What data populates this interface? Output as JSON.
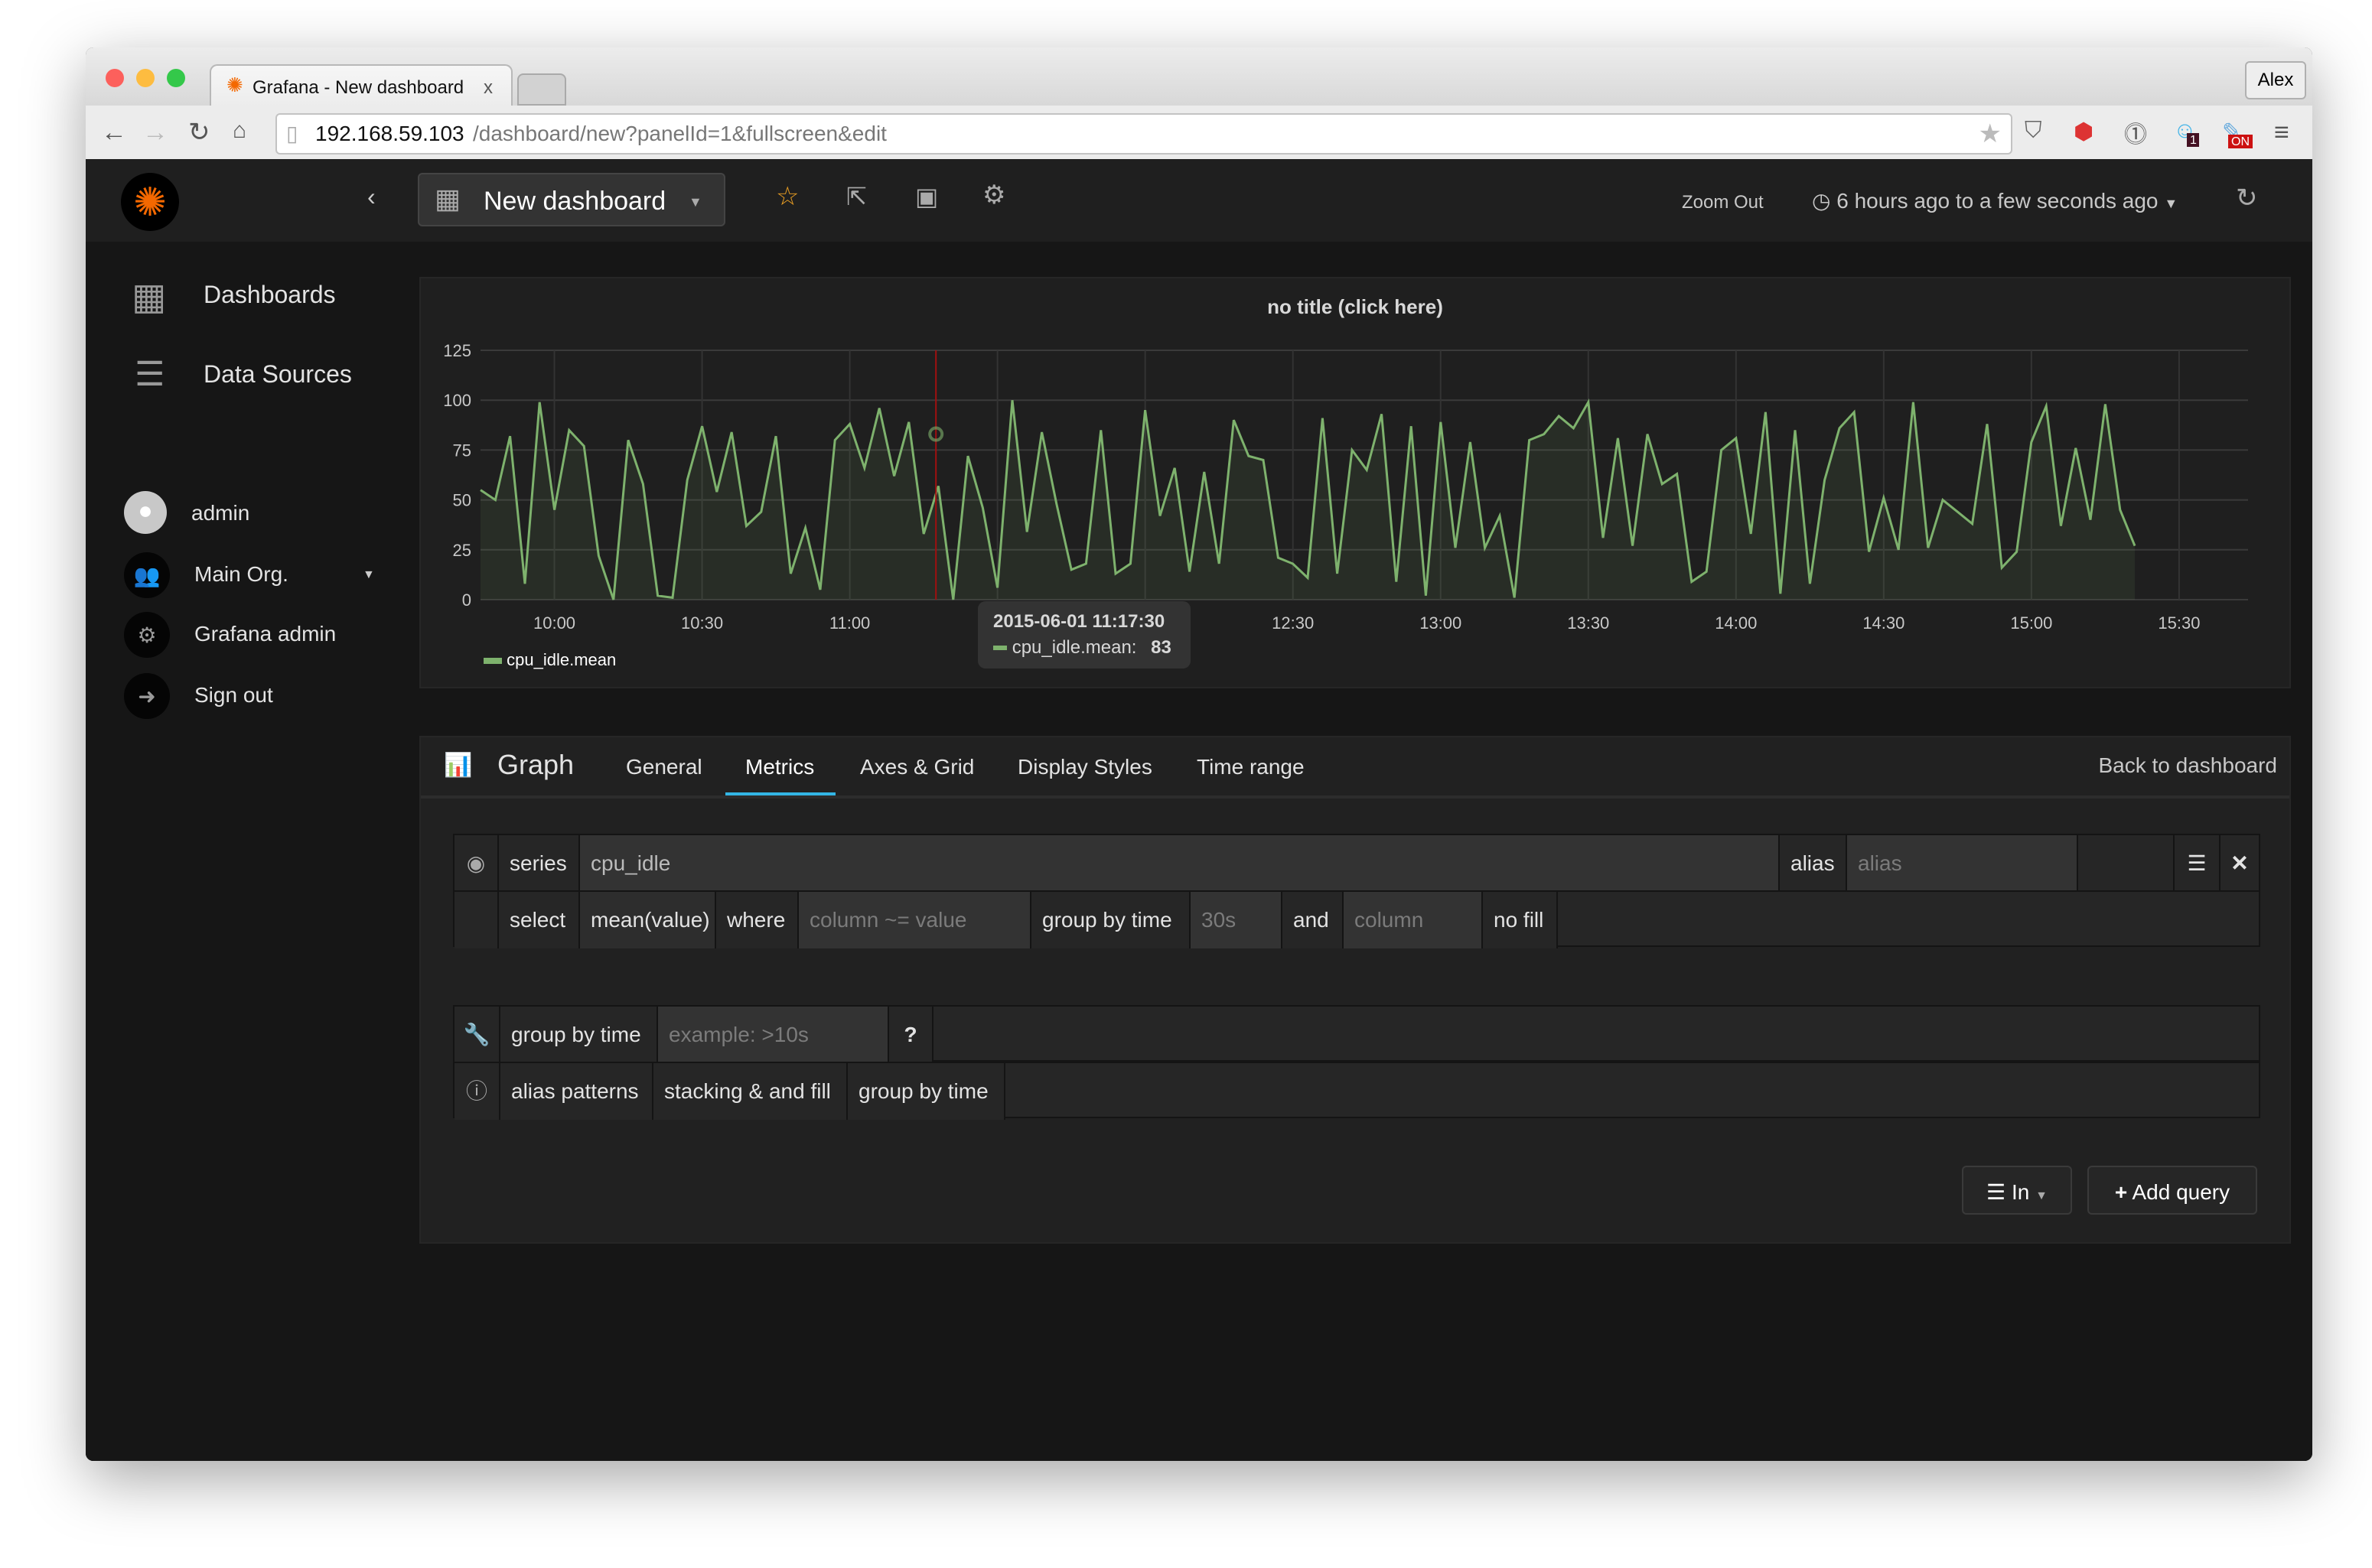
{
  "browser": {
    "tab_title": "Grafana - New dashboard",
    "tab_close": "x",
    "profile": "Alex",
    "url_host": "192.168.59.103",
    "url_path": "/dashboard/new?panelId=1&fullscreen&edit",
    "ext_badge_1": "1",
    "ext_badge_on": "ON"
  },
  "topnav": {
    "dashboard_title": "New dashboard",
    "zoom_out": "Zoom Out",
    "time_range": "6 hours ago to a few seconds ago"
  },
  "sidebar": {
    "items": [
      {
        "label": "Dashboards",
        "icon": "dashboards-icon"
      },
      {
        "label": "Data Sources",
        "icon": "database-icon"
      }
    ],
    "user": "admin",
    "org": "Main Org.",
    "admin": "Grafana admin",
    "signout": "Sign out"
  },
  "panel": {
    "title": "no title (click here)",
    "legend": "cpu_idle.mean",
    "tooltip": {
      "time": "2015-06-01 11:17:30",
      "series": "cpu_idle.mean:",
      "value": "83"
    }
  },
  "colors": {
    "series": "#7eb26d",
    "accent": "#33b5e5",
    "star": "#eb9f23",
    "crosshair": "#a01010"
  },
  "chart_data": {
    "type": "line",
    "title": "no title (click here)",
    "series": [
      {
        "name": "cpu_idle.mean",
        "values": [
          55,
          50,
          82,
          8,
          99,
          45,
          85,
          77,
          22,
          0,
          80,
          58,
          2,
          1,
          60,
          87,
          54,
          84,
          37,
          44,
          82,
          13,
          36,
          5,
          80,
          88,
          66,
          96,
          62,
          89,
          33,
          57,
          0,
          72,
          46,
          6,
          100,
          34,
          84,
          48,
          15,
          18,
          85,
          13,
          18,
          95,
          42,
          66,
          14,
          64,
          18,
          90,
          72,
          70,
          21,
          18,
          11,
          91,
          13,
          75,
          65,
          93,
          9,
          87,
          2,
          89,
          26,
          79,
          26,
          42,
          1,
          80,
          83,
          92,
          86,
          99,
          31,
          81,
          27,
          83,
          58,
          63,
          9,
          14,
          75,
          81,
          33,
          94,
          3,
          85,
          8,
          60,
          86,
          94,
          24,
          51,
          25,
          99,
          26,
          50,
          44,
          38,
          88,
          16,
          24,
          79,
          97,
          37,
          76,
          40,
          98,
          45,
          27
        ]
      }
    ],
    "x": [
      "09:45",
      "09:48",
      "09:51",
      "09:54",
      "09:57",
      "10:00",
      "10:03",
      "10:06",
      "10:09",
      "10:12",
      "10:15",
      "10:18",
      "10:21",
      "10:24",
      "10:27",
      "10:30",
      "10:33",
      "10:36",
      "10:39",
      "10:42",
      "10:45",
      "10:48",
      "10:51",
      "10:54",
      "10:57",
      "11:00",
      "11:03",
      "11:06",
      "11:09",
      "11:12",
      "11:15",
      "11:18",
      "11:21",
      "11:24",
      "11:27",
      "11:30",
      "11:33",
      "11:36",
      "11:39",
      "11:42",
      "11:45",
      "11:48",
      "11:51",
      "11:54",
      "11:57",
      "12:00",
      "12:03",
      "12:06",
      "12:09",
      "12:12",
      "12:15",
      "12:18",
      "12:21",
      "12:24",
      "12:27",
      "12:30",
      "12:33",
      "12:36",
      "12:39",
      "12:42",
      "12:45",
      "12:48",
      "12:51",
      "12:54",
      "12:57",
      "13:00",
      "13:03",
      "13:06",
      "13:09",
      "13:12",
      "13:15",
      "13:18",
      "13:21",
      "13:24",
      "13:27",
      "13:30",
      "13:33",
      "13:36",
      "13:39",
      "13:42",
      "13:45",
      "13:48",
      "13:51",
      "13:54",
      "13:57",
      "14:00",
      "14:03",
      "14:06",
      "14:09",
      "14:12",
      "14:15",
      "14:18",
      "14:21",
      "14:24",
      "14:27",
      "14:30",
      "14:33",
      "14:36",
      "14:39",
      "14:42",
      "14:45",
      "14:48",
      "14:51",
      "14:54",
      "14:57",
      "15:00",
      "15:03",
      "15:06",
      "15:09",
      "15:12",
      "15:15",
      "15:18",
      "15:21"
    ],
    "xticks": [
      "10:00",
      "10:30",
      "11:00",
      "11:30",
      "12:00",
      "12:30",
      "13:00",
      "13:30",
      "14:00",
      "14:30",
      "15:00",
      "15:30"
    ],
    "yticks": [
      "0",
      "25",
      "50",
      "75",
      "100",
      "125"
    ],
    "xlim": [
      "09:45",
      "15:44"
    ],
    "ylim": [
      0,
      125
    ],
    "grid": true,
    "legend": "bottom-left",
    "fill": true,
    "hover_time": "11:17:30"
  },
  "editor": {
    "panel_type": "Graph",
    "tabs": [
      "General",
      "Metrics",
      "Axes & Grid",
      "Display Styles",
      "Time range"
    ],
    "active_tab": "Metrics",
    "back": "Back to dashboard",
    "query": {
      "series_label": "series",
      "series_value": "cpu_idle",
      "alias_label": "alias",
      "alias_placeholder": "alias",
      "select_label": "select",
      "select_value": "mean(value)",
      "where_label": "where",
      "where_placeholder": "column ~= value",
      "groupby_label": "group by time",
      "groupby_value": "30s",
      "and_label": "and",
      "column_placeholder": "column",
      "fill": "no fill"
    },
    "options": {
      "groupby_label": "group by time",
      "groupby_placeholder": "example: >10s",
      "help": "?"
    },
    "help_links": [
      "alias patterns",
      "stacking & and fill",
      "group by time"
    ],
    "datasource_button": "In",
    "add_query": "Add query"
  }
}
